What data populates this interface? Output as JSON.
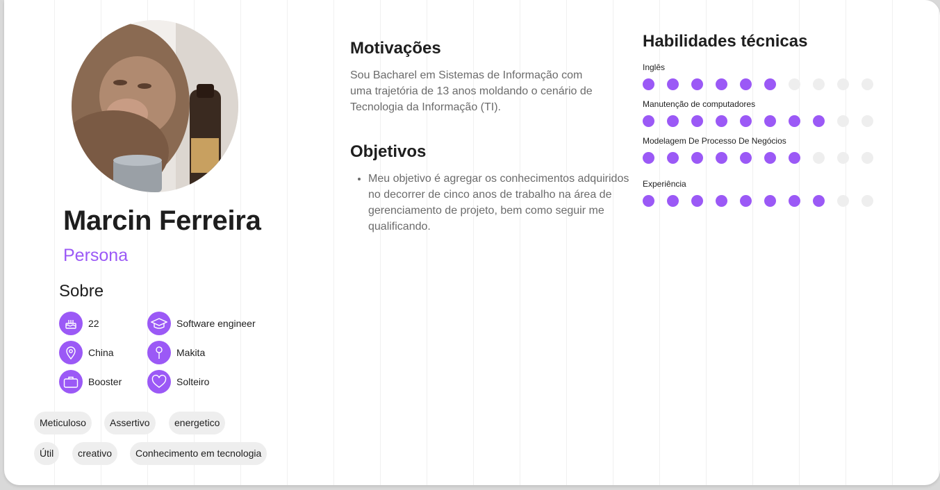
{
  "profile": {
    "name": "Marcin Ferreira",
    "role": "Persona",
    "about_title": "Sobre",
    "about": [
      {
        "icon": "cake-icon",
        "text": "22"
      },
      {
        "icon": "graduation-cap-icon",
        "text": "Software engineer"
      },
      {
        "icon": "location-pin-icon",
        "text": "China"
      },
      {
        "icon": "pin-icon",
        "text": "Makita"
      },
      {
        "icon": "briefcase-icon",
        "text": "Booster"
      },
      {
        "icon": "heart-icon",
        "text": "Solteiro"
      }
    ],
    "tags": [
      "Meticuloso",
      "Assertivo",
      "energetico",
      "Útil",
      "creativo",
      "Conhecimento em tecnologia"
    ]
  },
  "motivations": {
    "title": "Motivações",
    "text": "Sou Bacharel em Sistemas de Informação com uma trajetória de 13 anos moldando o cenário de Tecnologia da Informação (TI)."
  },
  "objectives": {
    "title": "Objetivos",
    "items": [
      "Meu objetivo é agregar os conhecimentos adquiridos no decorrer de cinco anos de trabalho na área de gerenciamento de projeto, bem como seguir me qualificando."
    ]
  },
  "skills": {
    "title": "Habilidades técnicas",
    "max": 10,
    "items": [
      {
        "label": "Inglês",
        "level": 6
      },
      {
        "label": "Manutenção de computadores",
        "level": 8
      },
      {
        "label": "Modelagem De Processo De Negócios",
        "level": 7
      },
      {
        "label": "Experiência",
        "level": 8
      }
    ]
  },
  "colors": {
    "accent": "#9b59f6",
    "inactive_dot": "#eeeeee",
    "heading": "#1e1e1e",
    "body_text": "#6b6b6b"
  }
}
